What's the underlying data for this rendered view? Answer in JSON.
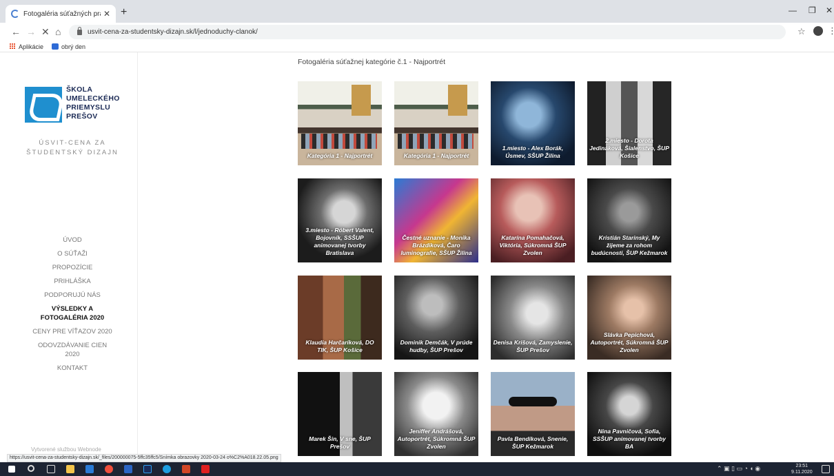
{
  "browser": {
    "tab_title": "Fotogaléria súťažných prác :: Úsv",
    "tab_close": "✕",
    "new_tab": "+",
    "url": "usvit-cena-za-studentsky-dizajn.sk/l/jednoduchy-clanok/",
    "bookmarks": [
      "Aplikácie",
      "obrý den"
    ],
    "status_url": "https://usvit-cena-za-studentsky-dizajn.sk/_files/200000075-5ffc35ffc5/Snímka obrazovky 2020-03-24 o%C2%A018.22.05.png"
  },
  "logo": {
    "lines": [
      "ŠKOLA",
      "UMELECKÉHO",
      "PRIEMYSLU",
      "PREŠOV"
    ]
  },
  "site_name": [
    "ÚSVIT-CENA ZA",
    "ŠTUDENTSKÝ DIZAJN"
  ],
  "nav": [
    {
      "label": "ÚVOD"
    },
    {
      "label": "O SÚŤAŽI"
    },
    {
      "label": "PROPOZÍCIE"
    },
    {
      "label": "PRIHLÁŠKA"
    },
    {
      "label": "PODPORUJÚ NÁS"
    },
    {
      "label": "VÝSLEDKY A FOTOGALÉRIA 2020",
      "active": true
    },
    {
      "label": "CENY PRE VÍŤAZOV 2020"
    },
    {
      "label": "ODOVZDÁVANIE CIEN 2020"
    },
    {
      "label": "KONTAKT"
    }
  ],
  "sidebar_footer": "Vytvorené službou Webnode",
  "gallery": {
    "title": "Fotogaléria súťažnej kategórie č.1 - Najportrét",
    "items": [
      "Kategória 1 - Najportrét",
      "Kategória 1 - Najportrét",
      "1.miesto - Alex Borák, Úsmev, SŠUP Žilina",
      "2.miesto - Dorota Jedináková, Šialenstvo, ŠUP Košice",
      "3.miesto - Róbert Valent, Bojovník, SSŠUP animovanej tvorby Bratislava",
      "Čestné uznanie - Monika Brázdiková, Čaro luminografie, SŠUP Žilina",
      "Katarína Pomahačová, Viktória, Súkromná ŠUP Zvolen",
      "Kristián Starinský, My žijeme za rohom budúcnosti, ŠUP Kežmarok",
      "Klaudia Harčaríková, DO TIK, ŠUP Košice",
      "Dominik Demčák, V prúde hudby, ŠUP Prešov",
      "Denisa Krišová, Zamyslenie, ŠUP Prešov",
      "Slávka Pepichová, Autoportrét, Súkromná ŠUP Zvolen",
      "Marek Šin, V sne, ŠUP Prešov",
      "Jeniffer Andrášová, Autoportrét, Súkromná ŠUP Zvolen",
      "Pavla Bendíková, Snenie, ŠUP Kežmarok",
      "Nina Pavničová, Sofia, SSŠUP animovanej tvorby BA"
    ]
  },
  "taskbar": {
    "clock_time": "23:51",
    "clock_date": "9.11.2020"
  }
}
